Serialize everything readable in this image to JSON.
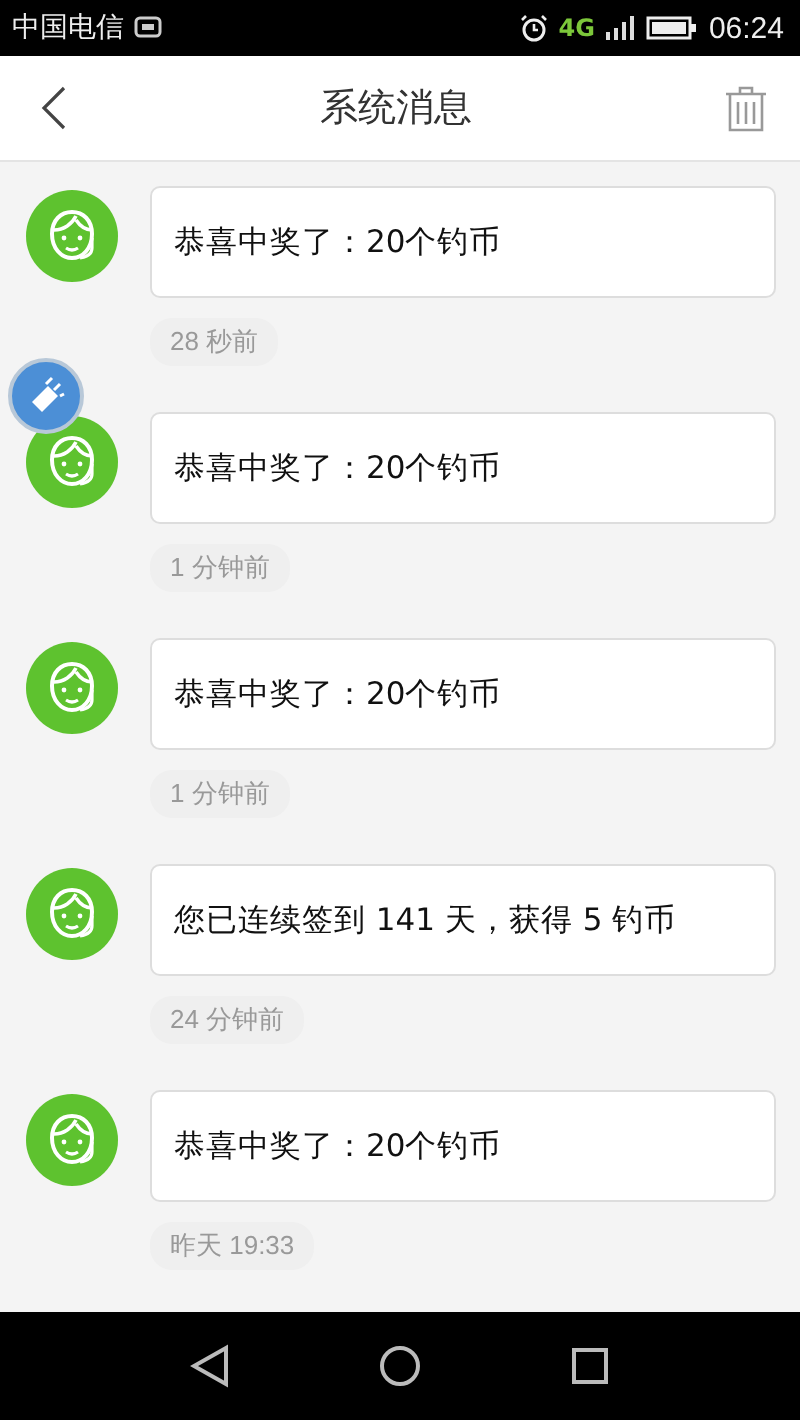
{
  "status_bar": {
    "carrier": "中国电信",
    "network": "4G",
    "time": "06:24"
  },
  "header": {
    "title": "系统消息"
  },
  "messages": [
    {
      "text": "恭喜中奖了：20个钓币",
      "time": "28 秒前"
    },
    {
      "text": "恭喜中奖了：20个钓币",
      "time": "1 分钟前"
    },
    {
      "text": "恭喜中奖了：20个钓币",
      "time": "1 分钟前"
    },
    {
      "text": "您已连续签到 141 天，获得 5 钓币",
      "time": "24 分钟前"
    },
    {
      "text": "恭喜中奖了：20个钓币",
      "time": "昨天 19:33"
    }
  ]
}
